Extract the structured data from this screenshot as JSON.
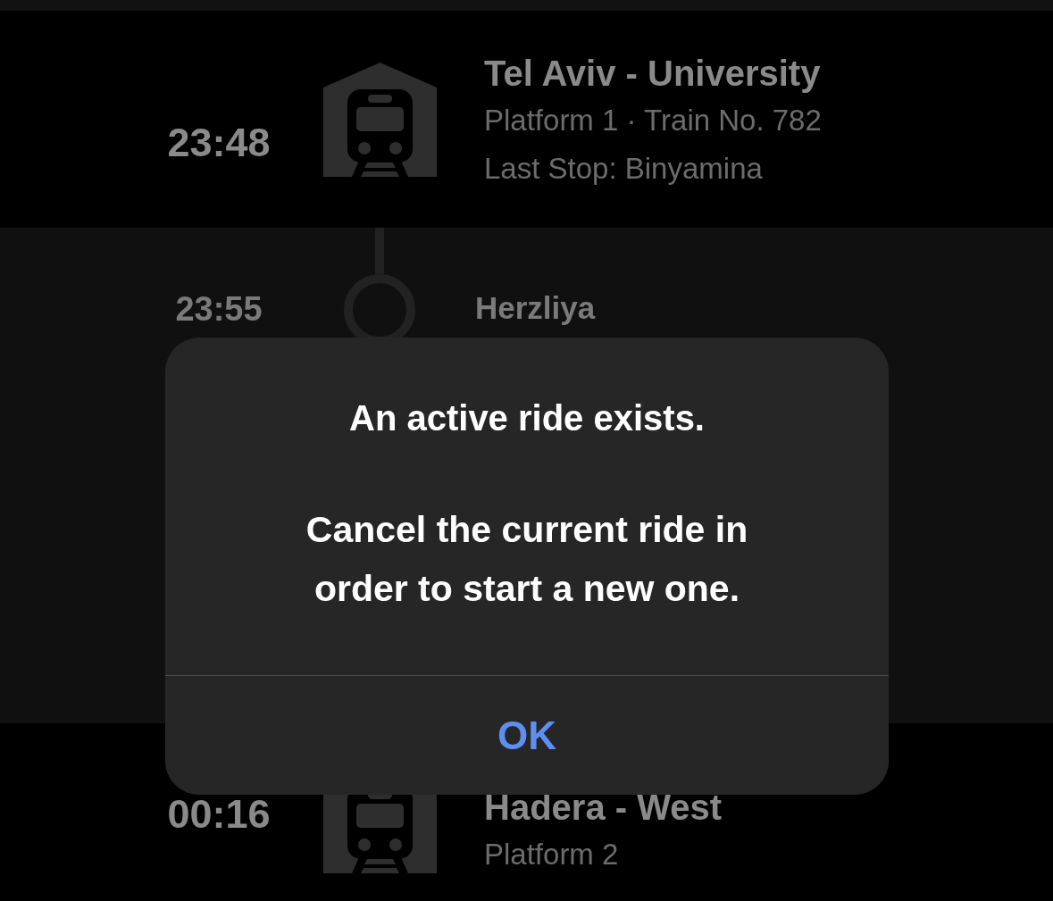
{
  "stations": [
    {
      "kind": "origin",
      "time": "23:48",
      "name": "Tel Aviv - University",
      "details": "Platform 1 · Train No. 782",
      "last_stop": "Last Stop: Binyamina"
    },
    {
      "kind": "stop",
      "time": "23:55",
      "name": "Herzliya"
    },
    {
      "kind": "destination",
      "time": "00:16",
      "name": "Hadera - West",
      "details": "Platform 2"
    }
  ],
  "alert": {
    "title": "An active ride exists.",
    "message": "Cancel the current ride in order to start a new one.",
    "buttons": [
      "OK"
    ]
  }
}
